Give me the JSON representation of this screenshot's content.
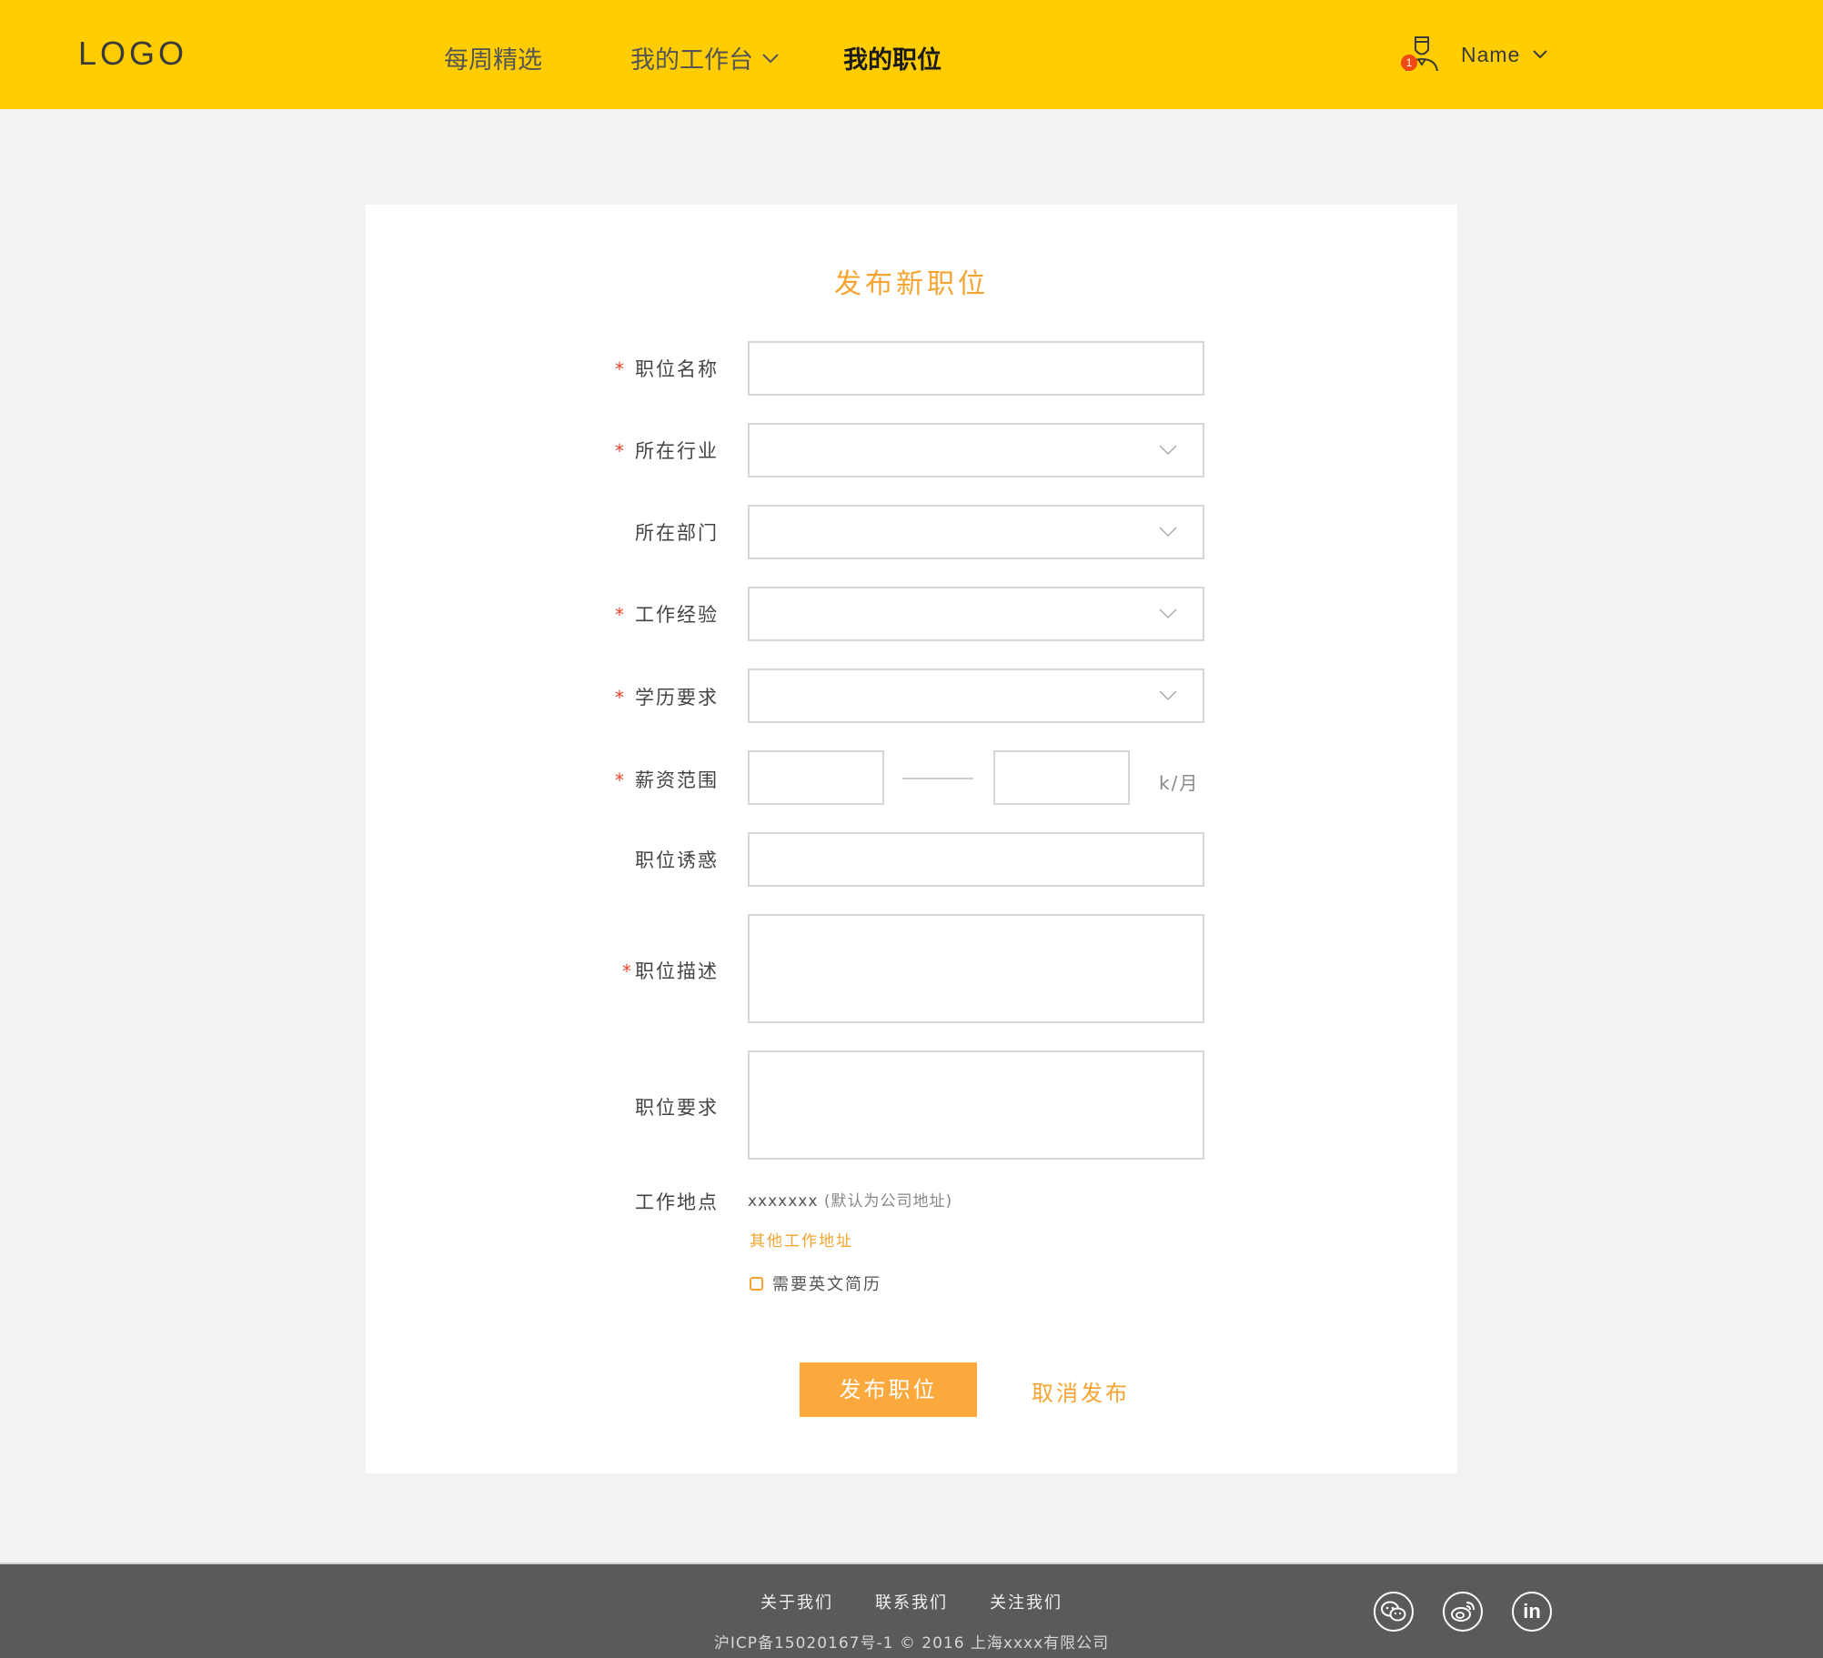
{
  "header": {
    "logo": "LOGO",
    "nav": [
      {
        "label": "每周精选"
      },
      {
        "label": "我的工作台"
      },
      {
        "label": "我的职位"
      }
    ],
    "user": {
      "name": "Name",
      "notifications": "1"
    }
  },
  "form": {
    "title": "发布新职位",
    "required_mark": "*",
    "fields": [
      {
        "label": "职位名称",
        "required": true,
        "type": "text",
        "value": ""
      },
      {
        "label": "所在行业",
        "required": true,
        "type": "select",
        "value": ""
      },
      {
        "label": "所在部门",
        "required": false,
        "type": "select",
        "value": ""
      },
      {
        "label": "工作经验",
        "required": true,
        "type": "select",
        "value": ""
      },
      {
        "label": "学历要求",
        "required": true,
        "type": "select",
        "value": ""
      },
      {
        "label": "薪资范围",
        "required": true,
        "type": "range",
        "min": "",
        "max": "",
        "unit": "k/月"
      },
      {
        "label": "职位诱惑",
        "required": false,
        "type": "text",
        "value": ""
      },
      {
        "label": "职位描述",
        "required": true,
        "type": "textarea",
        "value": ""
      },
      {
        "label": "职位要求",
        "required": false,
        "type": "textarea",
        "value": ""
      },
      {
        "label": "工作地点",
        "required": false,
        "type": "static"
      }
    ],
    "location": {
      "address": "xxxxxxx",
      "note": "(默认为公司地址)",
      "other_link": "其他工作地址"
    },
    "english_resume": {
      "label": "需要英文简历",
      "checked": false
    },
    "submit_label": "发布职位",
    "cancel_label": "取消发布"
  },
  "footer": {
    "links": [
      {
        "label": "关于我们"
      },
      {
        "label": "联系我们"
      },
      {
        "label": "关注我们"
      }
    ],
    "copyright": "沪ICP备15020167号-1 © 2016 上海xxxx有限公司",
    "social": [
      {
        "icon": "wechat-icon"
      },
      {
        "icon": "weibo-icon"
      },
      {
        "icon": "linkedin-icon",
        "text": "in"
      }
    ]
  }
}
